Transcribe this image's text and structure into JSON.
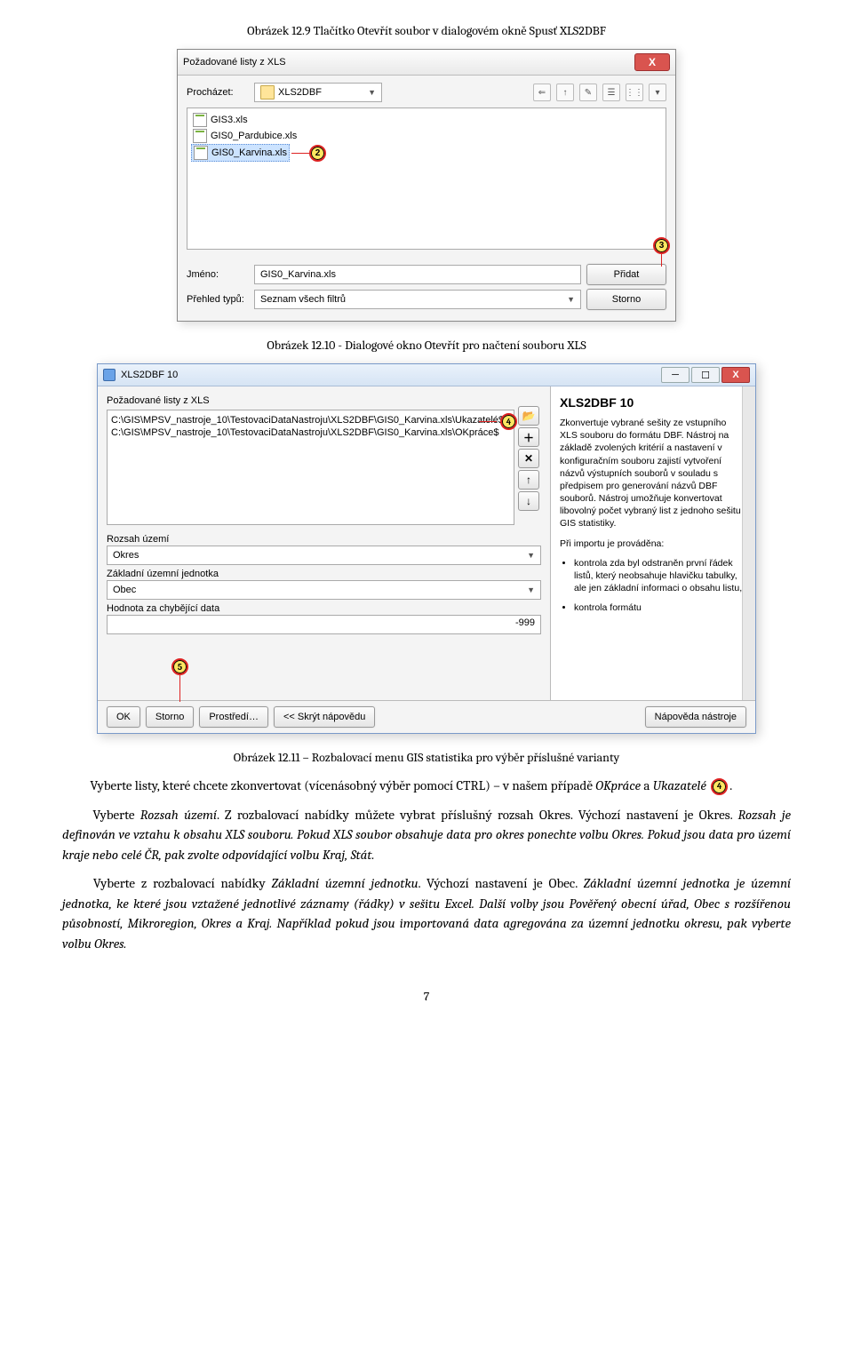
{
  "captions": {
    "c1": "Obrázek 12.9 Tlačítko Otevřít soubor v dialogovém okně Spusť XLS2DBF",
    "c2": "Obrázek 12.10 - Dialogové okno Otevřít pro načtení souboru XLS",
    "c3": "Obrázek 12.11 – Rozbalovací menu GIS statistika pro výběr příslušné varianty"
  },
  "dlg1": {
    "title": "Požadované listy z XLS",
    "browse_label": "Procházet:",
    "folder": "XLS2DBF",
    "toolbar": [
      "⇐",
      "↑",
      "✎",
      "☰",
      "⋮⋮",
      "▾"
    ],
    "files": [
      {
        "name": "GIS3.xls",
        "selected": false
      },
      {
        "name": "GIS0_Pardubice.xls",
        "selected": false
      },
      {
        "name": "GIS0_Karvina.xls",
        "selected": true
      }
    ],
    "marker2": "2",
    "marker3": "3",
    "name_label": "Jméno:",
    "name_value": "GIS0_Karvina.xls",
    "type_label": "Přehled typů:",
    "type_value": "Seznam všech filtrů",
    "btn_add": "Přidat",
    "btn_cancel": "Storno"
  },
  "dlg2": {
    "title": "XLS2DBF 10",
    "left_label": "Požadované listy z XLS",
    "paths": [
      "C:\\GIS\\MPSV_nastroje_10\\TestovaciDataNastroju\\XLS2DBF\\GIS0_Karvina.xls\\Ukazatelé$",
      "C:\\GIS\\MPSV_nastroje_10\\TestovaciDataNastroju\\XLS2DBF\\GIS0_Karvina.xls\\OKpráce$"
    ],
    "side_btns": [
      "📂",
      "＋",
      "✕",
      "↑",
      "↓"
    ],
    "marker4": "4",
    "marker5": "5",
    "rozsah_label": "Rozsah území",
    "rozsah_value": "Okres",
    "zuj_label": "Základní územní jednotka",
    "zuj_value": "Obec",
    "miss_label": "Hodnota za chybějící data",
    "miss_value": "-999",
    "footer": {
      "ok": "OK",
      "storno": "Storno",
      "prostredi": "Prostředí…",
      "skryt": "<< Skrýt nápovědu",
      "napoveda": "Nápověda nástroje"
    },
    "help": {
      "title": "XLS2DBF 10",
      "p1": "Zkonvertuje vybrané sešity ze vstupního XLS souboru do formátu DBF. Nástroj na základě zvolených kritérií a nastavení v konfiguračním souboru zajistí vytvoření názvů výstupních souborů v souladu s předpisem pro generování názvů DBF souborů. Nástroj umožňuje konvertovat libovolný počet vybraný list z jednoho sešitu GIS statistiky.",
      "p2": "Při importu je prováděna:",
      "li1": "kontrola zda byl odstraněn první řádek listů, který neobsahuje hlavičku tabulky, ale jen základní informaci o obsahu listu,",
      "li2": "kontrola formátu"
    }
  },
  "body": {
    "p1a": "Vyberte listy, které chcete zkonvertovat (vícenásobný výběr pomocí CTRL) – v našem případě ",
    "p1b": "OKpráce",
    "p1c": " a ",
    "p1d": "Ukazatelé",
    "p1e": " ",
    "p1f": ".",
    "marker4_inline": "4",
    "p2a": "Vyberte ",
    "p2b": "Rozsah území",
    "p2c": ". Z rozbalovací nabídky můžete vybrat příslušný rozsah Okres. Výchozí nastavení je Okres. ",
    "p2d": "Rozsah je definován ve vztahu k obsahu XLS souboru. Pokud XLS soubor obsahuje data pro okres ponechte volbu Okres. Pokud jsou data pro území kraje nebo celé ČR, pak zvolte odpovídající volbu Kraj, Stát.",
    "p3a": "Vyberte z rozbalovací nabídky ",
    "p3b": "Základní územní jednotku",
    "p3c": ". Výchozí nastavení je Obec. ",
    "p3d": "Základní územní jednotka je územní jednotka, ke které jsou vztažené jednotlivé záznamy (řádky) v sešitu Excel. Další volby jsou Pověřený obecní úřad, Obec s rozšířenou působností, Mikroregion, Okres a Kraj. Například pokud jsou importovaná data agregována za územní jednotku okresu, pak vyberte volbu Okres."
  },
  "pagenum": "7"
}
